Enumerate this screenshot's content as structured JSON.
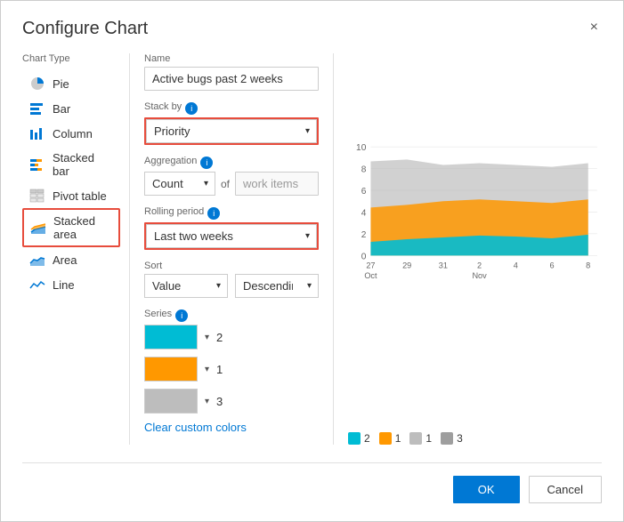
{
  "dialog": {
    "title": "Configure Chart",
    "close_label": "×"
  },
  "chart_type_panel": {
    "label": "Chart Type",
    "items": [
      {
        "id": "pie",
        "label": "Pie",
        "icon": "pie"
      },
      {
        "id": "bar",
        "label": "Bar",
        "icon": "bar"
      },
      {
        "id": "column",
        "label": "Column",
        "icon": "column"
      },
      {
        "id": "stacked-bar",
        "label": "Stacked bar",
        "icon": "stacked-bar"
      },
      {
        "id": "pivot-table",
        "label": "Pivot table",
        "icon": "pivot"
      },
      {
        "id": "stacked-area",
        "label": "Stacked area",
        "icon": "stacked-area",
        "selected": true
      },
      {
        "id": "area",
        "label": "Area",
        "icon": "area"
      },
      {
        "id": "line",
        "label": "Line",
        "icon": "line"
      }
    ]
  },
  "options": {
    "name_label": "Name",
    "name_value": "Active bugs past 2 weeks",
    "stack_by_label": "Stack by",
    "stack_by_value": "Priority",
    "stack_by_highlighted": true,
    "aggregation_label": "Aggregation",
    "aggregation_value": "Count",
    "aggregation_of": "of",
    "aggregation_items": "work items",
    "rolling_period_label": "Rolling period",
    "rolling_period_value": "Last two weeks",
    "rolling_period_highlighted": true,
    "sort_label": "Sort",
    "sort_value": "Value",
    "sort_order": "Descending",
    "series_label": "Series",
    "series": [
      {
        "color": "#00bcd4",
        "label": "2"
      },
      {
        "color": "#ff9800",
        "label": "1"
      },
      {
        "color": "#bdbdbd",
        "label": "3"
      }
    ],
    "clear_colors_label": "Clear custom colors"
  },
  "chart": {
    "y_max": 10,
    "y_labels": [
      "10",
      "8",
      "6",
      "4",
      "2",
      "0"
    ],
    "x_labels": [
      "27\nOct",
      "29",
      "31",
      "2",
      "4",
      "6",
      "8"
    ],
    "x_labels_main": [
      "27",
      "29",
      "31",
      "2",
      "4",
      "6",
      "8"
    ],
    "x_sub": [
      "Oct",
      "",
      "",
      "Nov",
      "",
      "",
      ""
    ]
  },
  "legend": [
    {
      "color": "#00bcd4",
      "label": "2"
    },
    {
      "color": "#ff9800",
      "label": "1"
    },
    {
      "color": "#bdbdbd",
      "label": "1"
    },
    {
      "color": "#9e9e9e",
      "label": "3"
    }
  ],
  "footer": {
    "ok_label": "OK",
    "cancel_label": "Cancel"
  }
}
